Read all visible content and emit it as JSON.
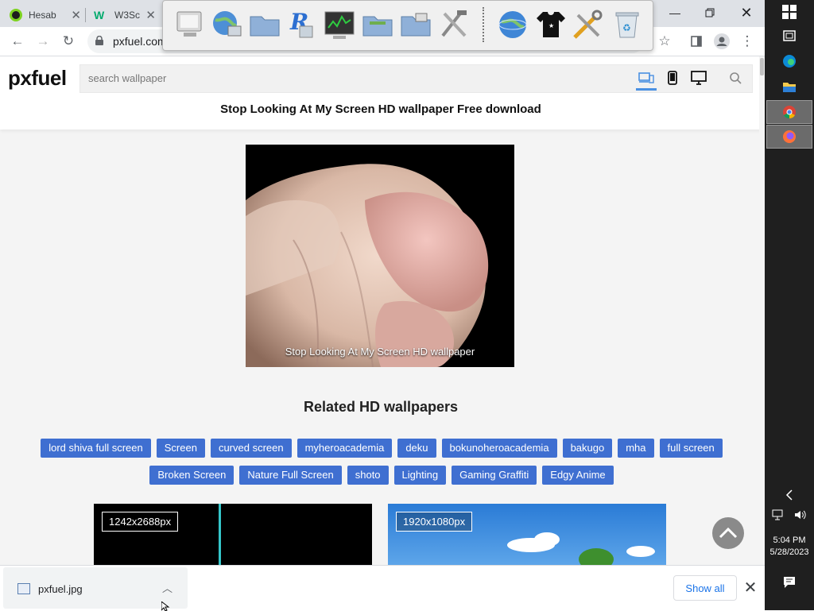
{
  "browser": {
    "tabs": [
      {
        "title": "Hesab",
        "favicon_color": "#1d1d1d"
      },
      {
        "title": "W3Sc",
        "favicon_color": "#04aa6d"
      }
    ],
    "url": "pxfuel.com"
  },
  "page": {
    "logo": "pxfuel",
    "search_placeholder": "search wallpaper",
    "title": "Stop Looking At My Screen HD wallpaper Free download",
    "image_caption": "Stop Looking At My Screen HD wallpaper",
    "related_heading": "Related HD wallpapers",
    "tags": [
      "lord shiva full screen",
      "Screen",
      "curved screen",
      "myheroacademia",
      "deku",
      "bokunoheroacademia",
      "bakugo",
      "mha",
      "full screen",
      "Broken Screen",
      "Nature Full Screen",
      "shoto",
      "Lighting",
      "Gaming Graffiti",
      "Edgy Anime"
    ],
    "thumbnails": [
      {
        "resolution": "1242x2688px"
      },
      {
        "resolution": "1920x1080px"
      }
    ]
  },
  "downloads": {
    "file_name": "pxfuel.jpg",
    "show_all": "Show all"
  },
  "taskbar": {
    "time": "5:04 PM",
    "date": "5/28/2023"
  },
  "colors": {
    "tag_bg": "#3f6fd1",
    "accent": "#4a90e2",
    "link": "#1a73e8"
  }
}
